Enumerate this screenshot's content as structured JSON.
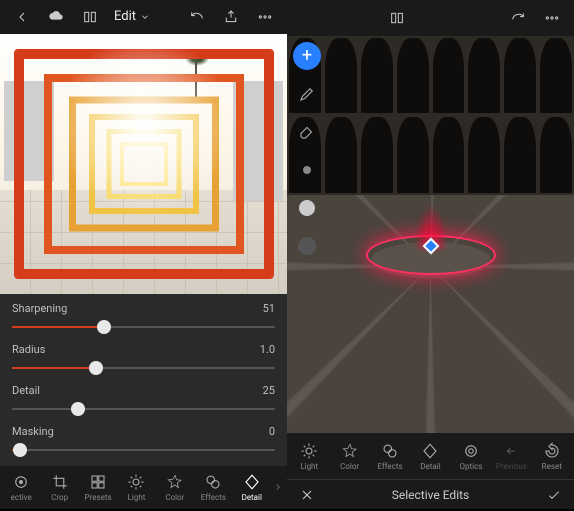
{
  "left": {
    "topbar": {
      "edit_label": "Edit"
    },
    "sliders": [
      {
        "label": "Sharpening",
        "value": 51,
        "pos": 35,
        "fill_from_center": false,
        "fill_len": 35
      },
      {
        "label": "Radius",
        "value": "1.0",
        "pos": 32,
        "fill_from_center": false,
        "fill_len": 32
      },
      {
        "label": "Detail",
        "value": 25,
        "pos": 25,
        "fill_from_center": true,
        "fill_len": 0
      },
      {
        "label": "Masking",
        "value": 0,
        "pos": 3,
        "fill_from_center": false,
        "fill_len": 3
      }
    ],
    "tools": [
      {
        "id": "selective",
        "label": "ective",
        "active": false
      },
      {
        "id": "crop",
        "label": "Crop",
        "active": false
      },
      {
        "id": "presets",
        "label": "Presets",
        "active": false
      },
      {
        "id": "light",
        "label": "Light",
        "active": false
      },
      {
        "id": "color",
        "label": "Color",
        "active": false
      },
      {
        "id": "effects",
        "label": "Effects",
        "active": false
      },
      {
        "id": "detail",
        "label": "Detail",
        "active": true
      }
    ]
  },
  "right": {
    "tools": [
      {
        "id": "light",
        "label": "Light",
        "active": false
      },
      {
        "id": "color",
        "label": "Color",
        "active": false
      },
      {
        "id": "effects",
        "label": "Effects",
        "active": false
      },
      {
        "id": "detail",
        "label": "Detail",
        "active": false
      },
      {
        "id": "optics",
        "label": "Optics",
        "active": false
      },
      {
        "id": "previous",
        "label": "Previous",
        "active": false,
        "dim": true
      },
      {
        "id": "reset",
        "label": "Reset",
        "active": false
      }
    ],
    "selective_title": "Selective Edits"
  }
}
